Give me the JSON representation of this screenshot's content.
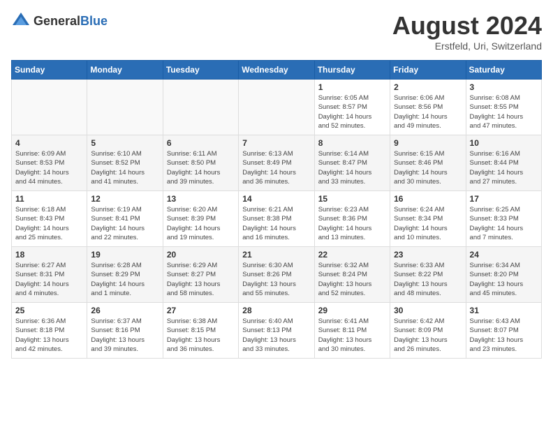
{
  "logo": {
    "general": "General",
    "blue": "Blue"
  },
  "title": {
    "month_year": "August 2024",
    "location": "Erstfeld, Uri, Switzerland"
  },
  "days_of_week": [
    "Sunday",
    "Monday",
    "Tuesday",
    "Wednesday",
    "Thursday",
    "Friday",
    "Saturday"
  ],
  "weeks": [
    [
      {
        "day": "",
        "info": ""
      },
      {
        "day": "",
        "info": ""
      },
      {
        "day": "",
        "info": ""
      },
      {
        "day": "",
        "info": ""
      },
      {
        "day": "1",
        "info": "Sunrise: 6:05 AM\nSunset: 8:57 PM\nDaylight: 14 hours\nand 52 minutes."
      },
      {
        "day": "2",
        "info": "Sunrise: 6:06 AM\nSunset: 8:56 PM\nDaylight: 14 hours\nand 49 minutes."
      },
      {
        "day": "3",
        "info": "Sunrise: 6:08 AM\nSunset: 8:55 PM\nDaylight: 14 hours\nand 47 minutes."
      }
    ],
    [
      {
        "day": "4",
        "info": "Sunrise: 6:09 AM\nSunset: 8:53 PM\nDaylight: 14 hours\nand 44 minutes."
      },
      {
        "day": "5",
        "info": "Sunrise: 6:10 AM\nSunset: 8:52 PM\nDaylight: 14 hours\nand 41 minutes."
      },
      {
        "day": "6",
        "info": "Sunrise: 6:11 AM\nSunset: 8:50 PM\nDaylight: 14 hours\nand 39 minutes."
      },
      {
        "day": "7",
        "info": "Sunrise: 6:13 AM\nSunset: 8:49 PM\nDaylight: 14 hours\nand 36 minutes."
      },
      {
        "day": "8",
        "info": "Sunrise: 6:14 AM\nSunset: 8:47 PM\nDaylight: 14 hours\nand 33 minutes."
      },
      {
        "day": "9",
        "info": "Sunrise: 6:15 AM\nSunset: 8:46 PM\nDaylight: 14 hours\nand 30 minutes."
      },
      {
        "day": "10",
        "info": "Sunrise: 6:16 AM\nSunset: 8:44 PM\nDaylight: 14 hours\nand 27 minutes."
      }
    ],
    [
      {
        "day": "11",
        "info": "Sunrise: 6:18 AM\nSunset: 8:43 PM\nDaylight: 14 hours\nand 25 minutes."
      },
      {
        "day": "12",
        "info": "Sunrise: 6:19 AM\nSunset: 8:41 PM\nDaylight: 14 hours\nand 22 minutes."
      },
      {
        "day": "13",
        "info": "Sunrise: 6:20 AM\nSunset: 8:39 PM\nDaylight: 14 hours\nand 19 minutes."
      },
      {
        "day": "14",
        "info": "Sunrise: 6:21 AM\nSunset: 8:38 PM\nDaylight: 14 hours\nand 16 minutes."
      },
      {
        "day": "15",
        "info": "Sunrise: 6:23 AM\nSunset: 8:36 PM\nDaylight: 14 hours\nand 13 minutes."
      },
      {
        "day": "16",
        "info": "Sunrise: 6:24 AM\nSunset: 8:34 PM\nDaylight: 14 hours\nand 10 minutes."
      },
      {
        "day": "17",
        "info": "Sunrise: 6:25 AM\nSunset: 8:33 PM\nDaylight: 14 hours\nand 7 minutes."
      }
    ],
    [
      {
        "day": "18",
        "info": "Sunrise: 6:27 AM\nSunset: 8:31 PM\nDaylight: 14 hours\nand 4 minutes."
      },
      {
        "day": "19",
        "info": "Sunrise: 6:28 AM\nSunset: 8:29 PM\nDaylight: 14 hours\nand 1 minute."
      },
      {
        "day": "20",
        "info": "Sunrise: 6:29 AM\nSunset: 8:27 PM\nDaylight: 13 hours\nand 58 minutes."
      },
      {
        "day": "21",
        "info": "Sunrise: 6:30 AM\nSunset: 8:26 PM\nDaylight: 13 hours\nand 55 minutes."
      },
      {
        "day": "22",
        "info": "Sunrise: 6:32 AM\nSunset: 8:24 PM\nDaylight: 13 hours\nand 52 minutes."
      },
      {
        "day": "23",
        "info": "Sunrise: 6:33 AM\nSunset: 8:22 PM\nDaylight: 13 hours\nand 48 minutes."
      },
      {
        "day": "24",
        "info": "Sunrise: 6:34 AM\nSunset: 8:20 PM\nDaylight: 13 hours\nand 45 minutes."
      }
    ],
    [
      {
        "day": "25",
        "info": "Sunrise: 6:36 AM\nSunset: 8:18 PM\nDaylight: 13 hours\nand 42 minutes."
      },
      {
        "day": "26",
        "info": "Sunrise: 6:37 AM\nSunset: 8:16 PM\nDaylight: 13 hours\nand 39 minutes."
      },
      {
        "day": "27",
        "info": "Sunrise: 6:38 AM\nSunset: 8:15 PM\nDaylight: 13 hours\nand 36 minutes."
      },
      {
        "day": "28",
        "info": "Sunrise: 6:40 AM\nSunset: 8:13 PM\nDaylight: 13 hours\nand 33 minutes."
      },
      {
        "day": "29",
        "info": "Sunrise: 6:41 AM\nSunset: 8:11 PM\nDaylight: 13 hours\nand 30 minutes."
      },
      {
        "day": "30",
        "info": "Sunrise: 6:42 AM\nSunset: 8:09 PM\nDaylight: 13 hours\nand 26 minutes."
      },
      {
        "day": "31",
        "info": "Sunrise: 6:43 AM\nSunset: 8:07 PM\nDaylight: 13 hours\nand 23 minutes."
      }
    ]
  ]
}
